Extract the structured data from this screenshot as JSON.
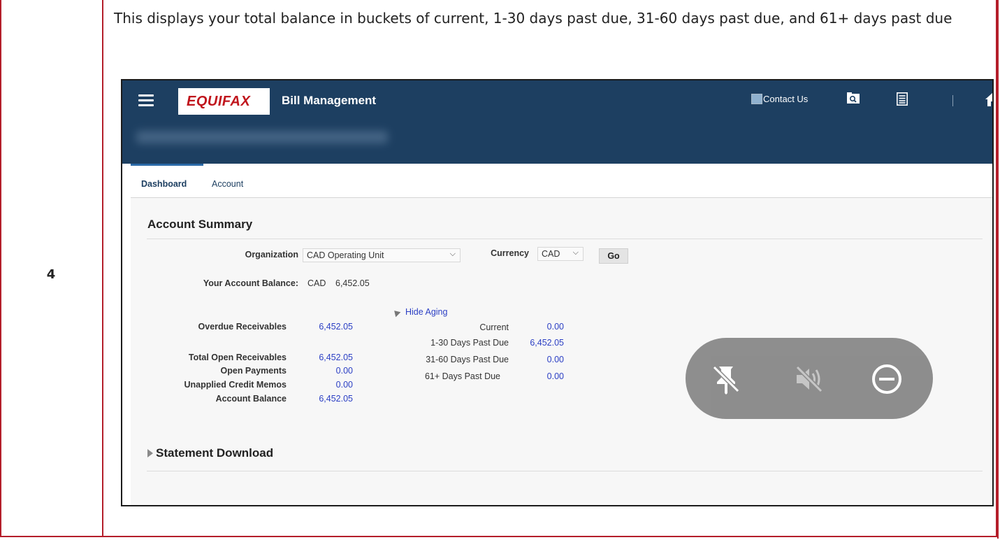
{
  "doc": {
    "step_number": "4",
    "instruction": "This displays your total balance in buckets of current, 1-30 days past due, 31-60 days past due, and 61+ days past due"
  },
  "header": {
    "logo_text": "EQUIFAX",
    "app_title": "Bill Management",
    "contact_label": "Contact Us",
    "icons": [
      "menu-icon",
      "search-folder-icon",
      "list-icon",
      "home-icon"
    ]
  },
  "tabs": [
    {
      "label": "Dashboard",
      "active": true
    },
    {
      "label": "Account",
      "active": false
    }
  ],
  "summary": {
    "title": "Account Summary",
    "organization_label": "Organization",
    "organization_value": "CAD Operating Unit",
    "currency_label": "Currency",
    "currency_value": "CAD",
    "go_label": "Go",
    "balance_label": "Your Account Balance:",
    "balance_currency": "CAD",
    "balance_value": "6,452.05",
    "hide_aging_label": "Hide Aging",
    "receivables": [
      {
        "label": "Overdue Receivables",
        "value": "6,452.05"
      },
      {
        "label": "Total Open Receivables",
        "value": "6,452.05"
      },
      {
        "label": "Open Payments",
        "value": "0.00"
      },
      {
        "label": "Unapplied Credit Memos",
        "value": "0.00"
      },
      {
        "label": "Account Balance",
        "value": "6,452.05"
      }
    ],
    "aging": [
      {
        "label": "Current",
        "value": "0.00"
      },
      {
        "label": "1-30 Days Past Due",
        "value": "6,452.05"
      },
      {
        "label": "31-60 Days Past Due",
        "value": "0.00"
      },
      {
        "label": "61+ Days Past Due",
        "value": "0.00"
      }
    ],
    "statement_label": "Statement Download"
  },
  "overlay": {
    "icons": [
      "unpin-icon",
      "mute-icon",
      "minus-circle-icon"
    ]
  },
  "colors": {
    "border_red": "#b41e2a",
    "header_navy": "#1d3f61",
    "link_blue": "#2b3fc4",
    "overlay_gray": "#888888"
  }
}
